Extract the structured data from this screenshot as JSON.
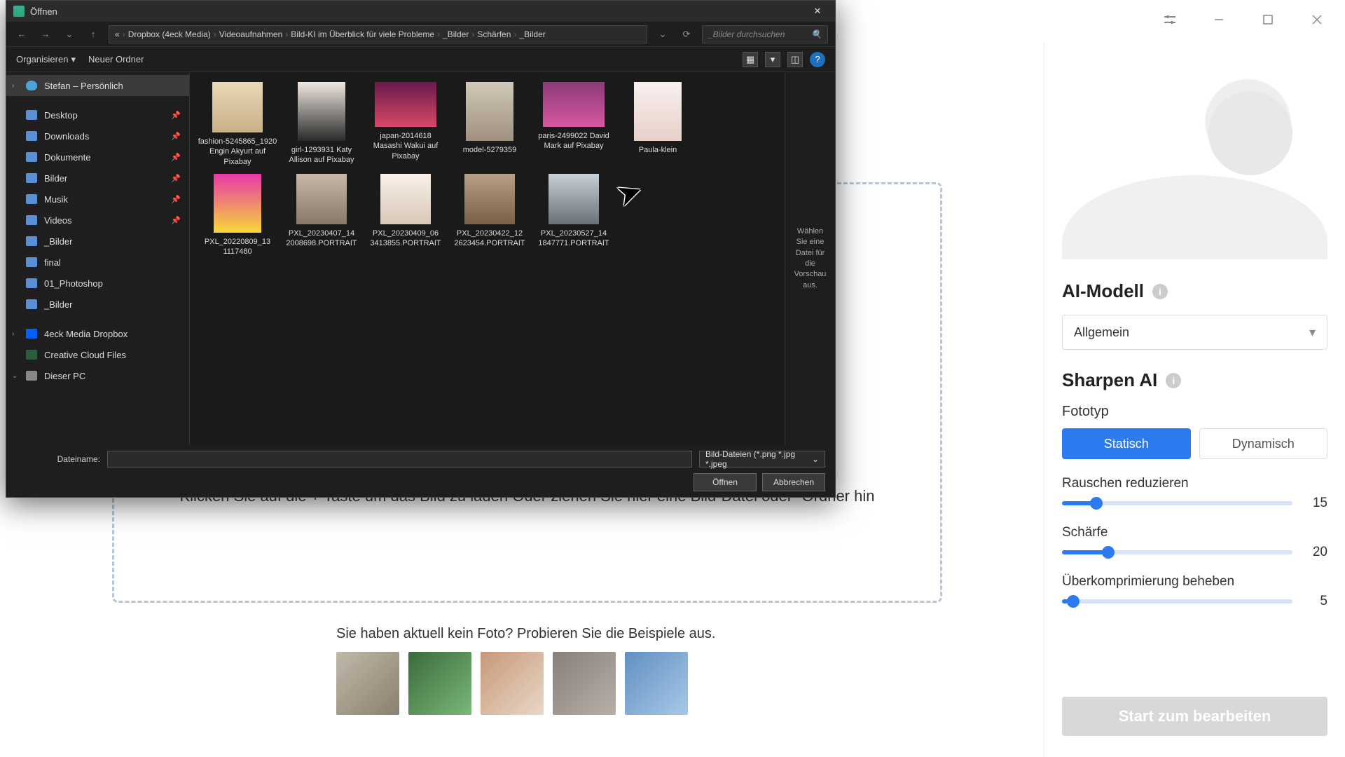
{
  "app": {
    "titlebar_icons": [
      "settings",
      "minimize",
      "maximize",
      "close"
    ]
  },
  "dropzone": {
    "hint": "Klicken Sie auf die + Taste um das Bild zu laden Oder ziehen Sie hier eine Bild-Datei oder -Ordner hin"
  },
  "samples": {
    "text": "Sie haben aktuell kein Foto? Probieren Sie die Beispiele aus."
  },
  "sidebar": {
    "ai_model_title": "AI-Modell",
    "model_select": "Allgemein",
    "sharpen_title": "Sharpen AI",
    "phototype_label": "Fototyp",
    "seg_static": "Statisch",
    "seg_dynamic": "Dynamisch",
    "slider_noise_label": "Rauschen reduzieren",
    "slider_noise_val": "15",
    "slider_sharp_label": "Schärfe",
    "slider_sharp_val": "20",
    "slider_comp_label": "Überkomprimierung beheben",
    "slider_comp_val": "5",
    "start_btn": "Start zum bearbeiten"
  },
  "dialog": {
    "title": "Öffnen",
    "breadcrumbs": [
      "«",
      "Dropbox (4eck Media)",
      "Videoaufnahmen",
      "Bild-KI im Überblick für viele Probleme",
      "_Bilder",
      "Schärfen",
      "_Bilder"
    ],
    "search_placeholder": "_Bilder durchsuchen",
    "organize": "Organisieren",
    "new_folder": "Neuer Ordner",
    "tree": [
      {
        "label": "Stefan – Persönlich",
        "selected": true,
        "icon": "cloud",
        "exp": ">"
      },
      {
        "sep": true
      },
      {
        "label": "Desktop",
        "pin": true
      },
      {
        "label": "Downloads",
        "pin": true
      },
      {
        "label": "Dokumente",
        "pin": true
      },
      {
        "label": "Bilder",
        "pin": true
      },
      {
        "label": "Musik",
        "pin": true
      },
      {
        "label": "Videos",
        "pin": true
      },
      {
        "label": "_Bilder"
      },
      {
        "label": "final"
      },
      {
        "label": "01_Photoshop"
      },
      {
        "label": "_Bilder"
      },
      {
        "sep": true
      },
      {
        "label": "4eck Media Dropbox",
        "icon": "db",
        "exp": ">"
      },
      {
        "label": "Creative Cloud Files",
        "icon": "cc"
      },
      {
        "label": "Dieser PC",
        "icon": "pc",
        "exp": "v"
      }
    ],
    "files": [
      {
        "name": "fashion-5245865_1920 Engin Akyurt auf Pixabay",
        "cls": "ft1 sq"
      },
      {
        "name": "girl-1293931 Katy Allison auf Pixabay",
        "cls": "ft2"
      },
      {
        "name": "japan-2014618 Masashi Wakui auf Pixabay",
        "cls": "ft3 wide"
      },
      {
        "name": "model-5279359",
        "cls": "ft4"
      },
      {
        "name": "paris-2499022 David Mark auf Pixabay",
        "cls": "ft5 wide"
      },
      {
        "name": "Paula-klein",
        "cls": "ft6"
      },
      {
        "name": "PXL_20220809_13 1117480",
        "cls": "ft7"
      },
      {
        "name": "PXL_20230407_14 2008698.PORTRAIT",
        "cls": "ft8 sq"
      },
      {
        "name": "PXL_20230409_06 3413855.PORTRAIT",
        "cls": "ft9 sq"
      },
      {
        "name": "PXL_20230422_12 2623454.PORTRAIT",
        "cls": "ft10 sq"
      },
      {
        "name": "PXL_20230527_14 1847771.PORTRAIT",
        "cls": "ft11 sq"
      }
    ],
    "preview_hint": "Wählen Sie eine Datei für die Vorschau aus.",
    "filename_label": "Dateiname:",
    "filetype": "Bild-Dateien (*.png *.jpg *.jpeg",
    "open_btn": "Öffnen",
    "cancel_btn": "Abbrechen"
  }
}
